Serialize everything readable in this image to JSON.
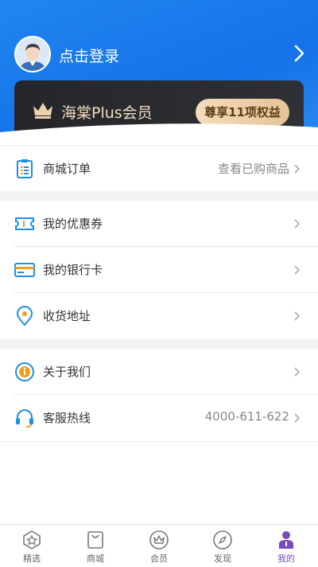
{
  "header": {
    "login_text": "点击登录",
    "plus_title": "海棠Plus会员",
    "plus_button": "尊享11项权益",
    "bg_color": "#1a7cec"
  },
  "menu": {
    "orders": {
      "label": "商城订单",
      "extra": "查看已购商品"
    },
    "coupons": {
      "label": "我的优惠券"
    },
    "bank_cards": {
      "label": "我的银行卡"
    },
    "address": {
      "label": "收货地址"
    },
    "about": {
      "label": "关于我们"
    },
    "hotline": {
      "label": "客服热线",
      "extra": "4000-611-622"
    }
  },
  "tabbar": {
    "items": [
      {
        "label": "精选",
        "icon": "star-shield-icon"
      },
      {
        "label": "商城",
        "icon": "shopping-bag-icon"
      },
      {
        "label": "会员",
        "icon": "crown-icon"
      },
      {
        "label": "发现",
        "icon": "compass-icon"
      },
      {
        "label": "我的",
        "icon": "profile-icon"
      }
    ],
    "active_index": 4,
    "active_color": "#7a4bb8"
  },
  "colors": {
    "accent_blue": "#1e8ee8",
    "gold": "#e5c397"
  }
}
